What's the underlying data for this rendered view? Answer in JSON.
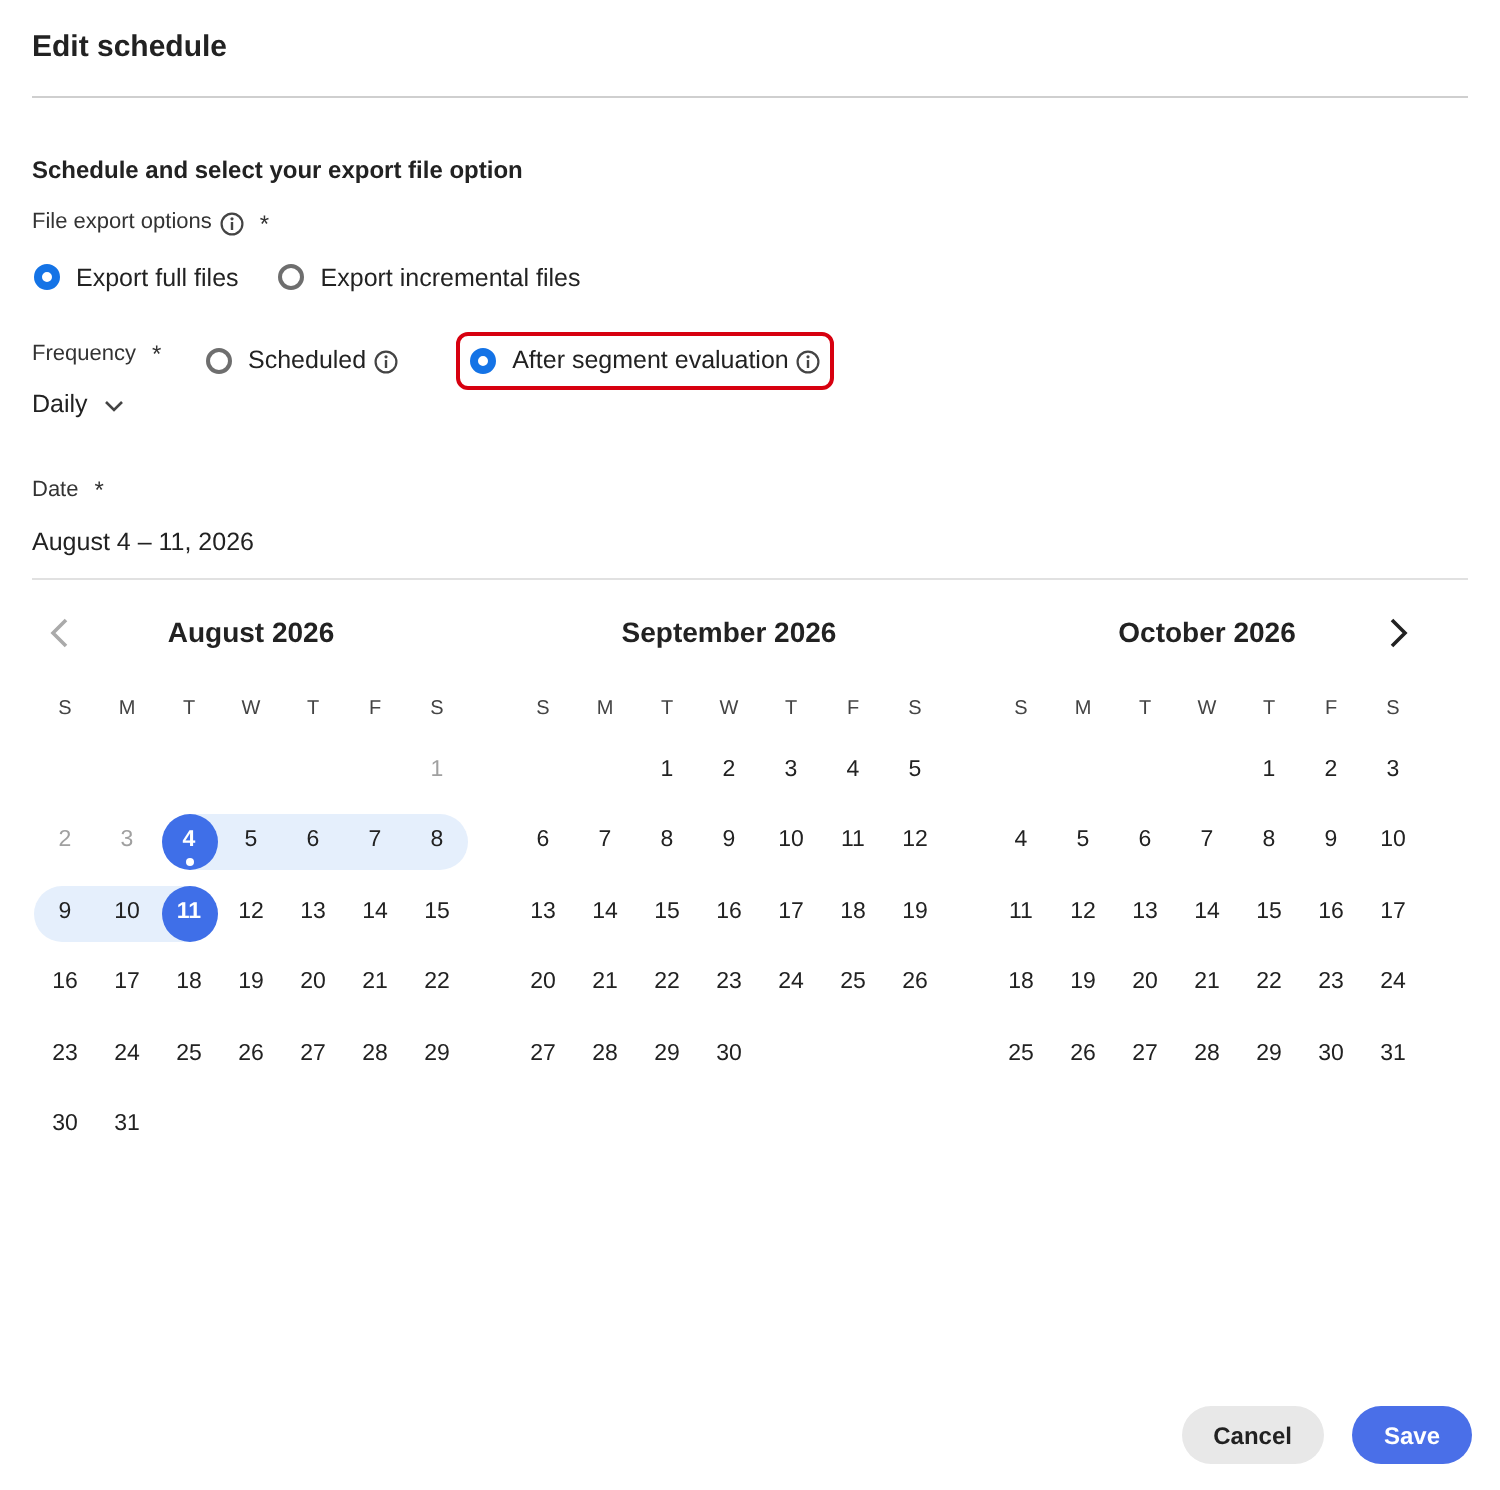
{
  "title": "Edit schedule",
  "section_title": "Schedule and select your export file option",
  "file_export": {
    "label": "File export options",
    "required_mark": "*",
    "options": [
      {
        "label": "Export full files",
        "selected": true
      },
      {
        "label": "Export incremental files",
        "selected": false
      }
    ]
  },
  "frequency": {
    "label": "Frequency",
    "required_mark": "*",
    "value": "Daily",
    "options": [
      {
        "label": "Scheduled",
        "selected": false,
        "highlighted": false
      },
      {
        "label": "After segment evaluation",
        "selected": true,
        "highlighted": true
      }
    ]
  },
  "date": {
    "label": "Date",
    "required_mark": "*",
    "value": "August 4 – 11, 2026"
  },
  "calendar": {
    "months": [
      {
        "title": "August 2026",
        "weekdays": [
          "S",
          "M",
          "T",
          "W",
          "T",
          "F",
          "S"
        ],
        "weeks": [
          [
            {
              "kind": "empty"
            },
            {
              "kind": "empty"
            },
            {
              "kind": "empty"
            },
            {
              "kind": "empty"
            },
            {
              "kind": "empty"
            },
            {
              "kind": "empty"
            },
            {
              "d": "1",
              "kind": "muted",
              "selected": false,
              "today": false
            }
          ],
          [
            {
              "d": "2",
              "kind": "muted",
              "selected": false,
              "today": false
            },
            {
              "d": "3",
              "kind": "muted",
              "selected": false,
              "today": false
            },
            {
              "d": "4",
              "kind": "range",
              "selected": true,
              "today": true
            },
            {
              "d": "5",
              "kind": "range",
              "selected": false,
              "today": false
            },
            {
              "d": "6",
              "kind": "range",
              "selected": false,
              "today": false
            },
            {
              "d": "7",
              "kind": "range",
              "selected": false,
              "today": false
            },
            {
              "d": "8",
              "kind": "range",
              "selected": false,
              "today": false
            }
          ],
          [
            {
              "d": "9",
              "kind": "range",
              "selected": false,
              "today": false
            },
            {
              "d": "10",
              "kind": "range",
              "selected": false,
              "today": false
            },
            {
              "d": "11",
              "kind": "range",
              "selected": true,
              "today": false
            },
            {
              "d": "12",
              "kind": "plain",
              "selected": false,
              "today": false
            },
            {
              "d": "13",
              "kind": "plain",
              "selected": false,
              "today": false
            },
            {
              "d": "14",
              "kind": "plain",
              "selected": false,
              "today": false
            },
            {
              "d": "15",
              "kind": "plain",
              "selected": false,
              "today": false
            }
          ],
          [
            {
              "d": "16",
              "kind": "plain",
              "selected": false,
              "today": false
            },
            {
              "d": "17",
              "kind": "plain",
              "selected": false,
              "today": false
            },
            {
              "d": "18",
              "kind": "plain",
              "selected": false,
              "today": false
            },
            {
              "d": "19",
              "kind": "plain",
              "selected": false,
              "today": false
            },
            {
              "d": "20",
              "kind": "plain",
              "selected": false,
              "today": false
            },
            {
              "d": "21",
              "kind": "plain",
              "selected": false,
              "today": false
            },
            {
              "d": "22",
              "kind": "plain",
              "selected": false,
              "today": false
            }
          ],
          [
            {
              "d": "23",
              "kind": "plain",
              "selected": false,
              "today": false
            },
            {
              "d": "24",
              "kind": "plain",
              "selected": false,
              "today": false
            },
            {
              "d": "25",
              "kind": "plain",
              "selected": false,
              "today": false
            },
            {
              "d": "26",
              "kind": "plain",
              "selected": false,
              "today": false
            },
            {
              "d": "27",
              "kind": "plain",
              "selected": false,
              "today": false
            },
            {
              "d": "28",
              "kind": "plain",
              "selected": false,
              "today": false
            },
            {
              "d": "29",
              "kind": "plain",
              "selected": false,
              "today": false
            }
          ],
          [
            {
              "d": "30",
              "kind": "plain",
              "selected": false,
              "today": false
            },
            {
              "d": "31",
              "kind": "plain",
              "selected": false,
              "today": false
            }
          ]
        ]
      },
      {
        "title": "September 2026",
        "weekdays": [
          "S",
          "M",
          "T",
          "W",
          "T",
          "F",
          "S"
        ],
        "weeks": [
          [
            {
              "kind": "empty"
            },
            {
              "kind": "empty"
            },
            {
              "d": "1",
              "kind": "plain",
              "selected": false,
              "today": false
            },
            {
              "d": "2",
              "kind": "plain",
              "selected": false,
              "today": false
            },
            {
              "d": "3",
              "kind": "plain",
              "selected": false,
              "today": false
            },
            {
              "d": "4",
              "kind": "plain",
              "selected": false,
              "today": false
            },
            {
              "d": "5",
              "kind": "plain",
              "selected": false,
              "today": false
            }
          ],
          [
            {
              "d": "6",
              "kind": "plain",
              "selected": false,
              "today": false
            },
            {
              "d": "7",
              "kind": "plain",
              "selected": false,
              "today": false
            },
            {
              "d": "8",
              "kind": "plain",
              "selected": false,
              "today": false
            },
            {
              "d": "9",
              "kind": "plain",
              "selected": false,
              "today": false
            },
            {
              "d": "10",
              "kind": "plain",
              "selected": false,
              "today": false
            },
            {
              "d": "11",
              "kind": "plain",
              "selected": false,
              "today": false
            },
            {
              "d": "12",
              "kind": "plain",
              "selected": false,
              "today": false
            }
          ],
          [
            {
              "d": "13",
              "kind": "plain",
              "selected": false,
              "today": false
            },
            {
              "d": "14",
              "kind": "plain",
              "selected": false,
              "today": false
            },
            {
              "d": "15",
              "kind": "plain",
              "selected": false,
              "today": false
            },
            {
              "d": "16",
              "kind": "plain",
              "selected": false,
              "today": false
            },
            {
              "d": "17",
              "kind": "plain",
              "selected": false,
              "today": false
            },
            {
              "d": "18",
              "kind": "plain",
              "selected": false,
              "today": false
            },
            {
              "d": "19",
              "kind": "plain",
              "selected": false,
              "today": false
            }
          ],
          [
            {
              "d": "20",
              "kind": "plain",
              "selected": false,
              "today": false
            },
            {
              "d": "21",
              "kind": "plain",
              "selected": false,
              "today": false
            },
            {
              "d": "22",
              "kind": "plain",
              "selected": false,
              "today": false
            },
            {
              "d": "23",
              "kind": "plain",
              "selected": false,
              "today": false
            },
            {
              "d": "24",
              "kind": "plain",
              "selected": false,
              "today": false
            },
            {
              "d": "25",
              "kind": "plain",
              "selected": false,
              "today": false
            },
            {
              "d": "26",
              "kind": "plain",
              "selected": false,
              "today": false
            }
          ],
          [
            {
              "d": "27",
              "kind": "plain",
              "selected": false,
              "today": false
            },
            {
              "d": "28",
              "kind": "plain",
              "selected": false,
              "today": false
            },
            {
              "d": "29",
              "kind": "plain",
              "selected": false,
              "today": false
            },
            {
              "d": "30",
              "kind": "plain",
              "selected": false,
              "today": false
            }
          ]
        ]
      },
      {
        "title": "October 2026",
        "weekdays": [
          "S",
          "M",
          "T",
          "W",
          "T",
          "F",
          "S"
        ],
        "weeks": [
          [
            {
              "kind": "empty"
            },
            {
              "kind": "empty"
            },
            {
              "kind": "empty"
            },
            {
              "kind": "empty"
            },
            {
              "d": "1",
              "kind": "plain",
              "selected": false,
              "today": false
            },
            {
              "d": "2",
              "kind": "plain",
              "selected": false,
              "today": false
            },
            {
              "d": "3",
              "kind": "plain",
              "selected": false,
              "today": false
            }
          ],
          [
            {
              "d": "4",
              "kind": "plain",
              "selected": false,
              "today": false
            },
            {
              "d": "5",
              "kind": "plain",
              "selected": false,
              "today": false
            },
            {
              "d": "6",
              "kind": "plain",
              "selected": false,
              "today": false
            },
            {
              "d": "7",
              "kind": "plain",
              "selected": false,
              "today": false
            },
            {
              "d": "8",
              "kind": "plain",
              "selected": false,
              "today": false
            },
            {
              "d": "9",
              "kind": "plain",
              "selected": false,
              "today": false
            },
            {
              "d": "10",
              "kind": "plain",
              "selected": false,
              "today": false
            }
          ],
          [
            {
              "d": "11",
              "kind": "plain",
              "selected": false,
              "today": false
            },
            {
              "d": "12",
              "kind": "plain",
              "selected": false,
              "today": false
            },
            {
              "d": "13",
              "kind": "plain",
              "selected": false,
              "today": false
            },
            {
              "d": "14",
              "kind": "plain",
              "selected": false,
              "today": false
            },
            {
              "d": "15",
              "kind": "plain",
              "selected": false,
              "today": false
            },
            {
              "d": "16",
              "kind": "plain",
              "selected": false,
              "today": false
            },
            {
              "d": "17",
              "kind": "plain",
              "selected": false,
              "today": false
            }
          ],
          [
            {
              "d": "18",
              "kind": "plain",
              "selected": false,
              "today": false
            },
            {
              "d": "19",
              "kind": "plain",
              "selected": false,
              "today": false
            },
            {
              "d": "20",
              "kind": "plain",
              "selected": false,
              "today": false
            },
            {
              "d": "21",
              "kind": "plain",
              "selected": false,
              "today": false
            },
            {
              "d": "22",
              "kind": "plain",
              "selected": false,
              "today": false
            },
            {
              "d": "23",
              "kind": "plain",
              "selected": false,
              "today": false
            },
            {
              "d": "24",
              "kind": "plain",
              "selected": false,
              "today": false
            }
          ],
          [
            {
              "d": "25",
              "kind": "plain",
              "selected": false,
              "today": false
            },
            {
              "d": "26",
              "kind": "plain",
              "selected": false,
              "today": false
            },
            {
              "d": "27",
              "kind": "plain",
              "selected": false,
              "today": false
            },
            {
              "d": "28",
              "kind": "plain",
              "selected": false,
              "today": false
            },
            {
              "d": "29",
              "kind": "plain",
              "selected": false,
              "today": false
            },
            {
              "d": "30",
              "kind": "plain",
              "selected": false,
              "today": false
            },
            {
              "d": "31",
              "kind": "plain",
              "selected": false,
              "today": false
            }
          ]
        ]
      }
    ]
  },
  "buttons": [
    {
      "label": "Cancel",
      "kind": "secondary"
    },
    {
      "label": "Save",
      "kind": "primary"
    }
  ]
}
